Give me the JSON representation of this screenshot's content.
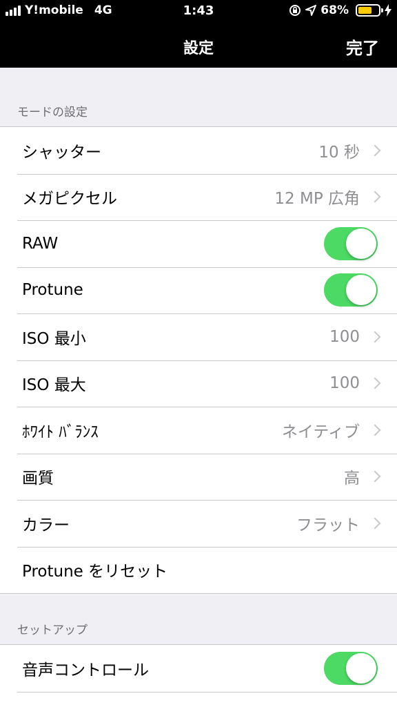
{
  "status_bar": {
    "carrier": "Y!mobile",
    "network": "4G",
    "time": "1:43",
    "battery_percent": "68%",
    "battery_level": 0.68,
    "battery_color": "#ffcc00"
  },
  "nav": {
    "title": "設定",
    "done_label": "完了"
  },
  "sections": [
    {
      "header": "モードの設定",
      "rows": [
        {
          "label": "シャッター",
          "value": "10 秒",
          "type": "disclosure"
        },
        {
          "label": "メガピクセル",
          "value": "12 MP 広角",
          "type": "disclosure"
        },
        {
          "label": "RAW",
          "type": "toggle",
          "on": true
        },
        {
          "label": "Protune",
          "type": "toggle",
          "on": true
        },
        {
          "label": "ISO 最小",
          "value": "100",
          "type": "disclosure"
        },
        {
          "label": "ISO 最大",
          "value": "100",
          "type": "disclosure"
        },
        {
          "label": "ﾎﾜｲﾄ ﾊﾞﾗﾝｽ",
          "value": "ネイティブ",
          "type": "disclosure"
        },
        {
          "label": "画質",
          "value": "高",
          "type": "disclosure"
        },
        {
          "label": "カラー",
          "value": "フラット",
          "type": "disclosure"
        },
        {
          "label": "Protune をリセット",
          "type": "action"
        }
      ]
    },
    {
      "header": "セットアップ",
      "rows": [
        {
          "label": "音声コントロール",
          "type": "toggle",
          "on": true
        }
      ]
    }
  ],
  "colors": {
    "toggle_on": "#4cd964",
    "background": "#efeff4",
    "secondary_text": "#8e8e93"
  }
}
